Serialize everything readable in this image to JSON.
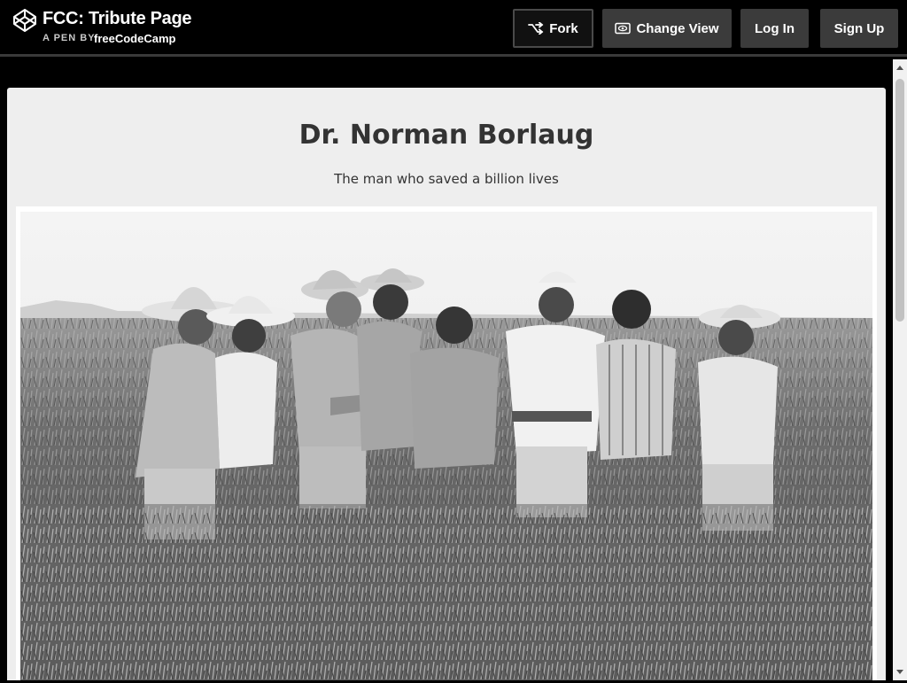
{
  "header": {
    "pen_title": "FCC: Tribute Page",
    "pen_by": "A PEN BY",
    "author": "freeCodeCamp",
    "buttons": {
      "fork": "Fork",
      "change_view": "Change View",
      "login": "Log In",
      "signup": "Sign Up"
    }
  },
  "preview": {
    "title": "Dr. Norman Borlaug",
    "subtitle": "The man who saved a billion lives"
  },
  "icons": {
    "logo": "codepen-logo-icon",
    "fork": "fork-icon",
    "change_view": "eye-view-icon"
  },
  "colors": {
    "header_bg": "#000000",
    "button_bg": "#3b3b3b",
    "preview_bg": "#eeeeee",
    "text_dark": "#333333"
  }
}
